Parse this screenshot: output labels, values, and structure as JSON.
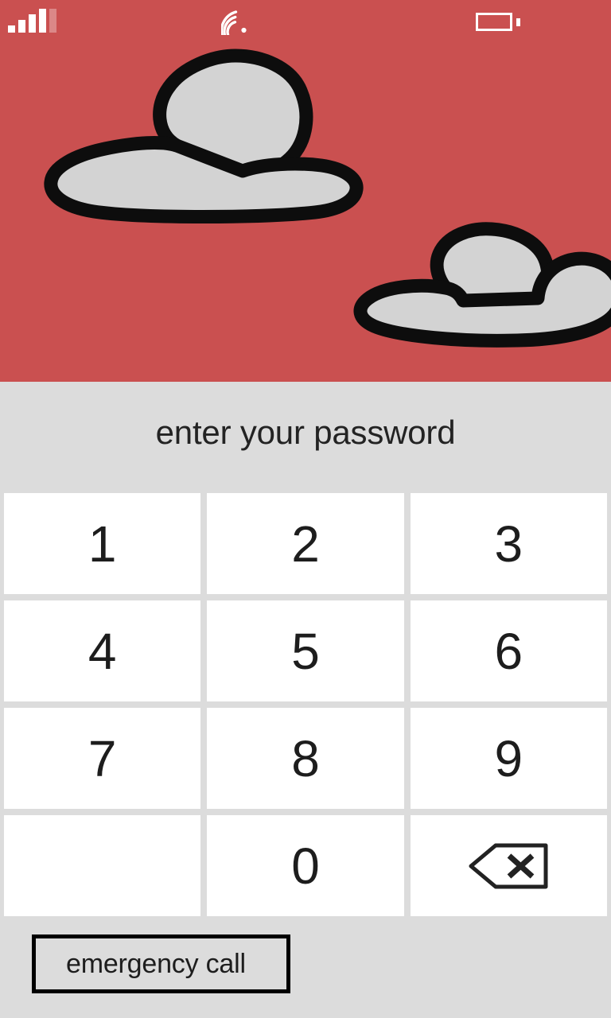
{
  "screen": {
    "name": "lock-screen-password-entry",
    "wallpaper_color": "#CA5050",
    "panel_color": "#DCDCDC",
    "cloud_fill": "#D3D3D3",
    "cloud_stroke": "#0D0D0D"
  },
  "statusbar": {
    "signal_icon": "signal-bars-icon",
    "signal_bars_filled": 4,
    "signal_bars_total": 5,
    "wifi_icon": "wifi-icon",
    "battery_icon": "battery-icon",
    "icon_color": "#FFFFFF"
  },
  "prompt": {
    "text": "enter your password"
  },
  "keypad": {
    "keys": [
      {
        "label": "1",
        "name": "key-1",
        "type": "digit"
      },
      {
        "label": "2",
        "name": "key-2",
        "type": "digit"
      },
      {
        "label": "3",
        "name": "key-3",
        "type": "digit"
      },
      {
        "label": "4",
        "name": "key-4",
        "type": "digit"
      },
      {
        "label": "5",
        "name": "key-5",
        "type": "digit"
      },
      {
        "label": "6",
        "name": "key-6",
        "type": "digit"
      },
      {
        "label": "7",
        "name": "key-7",
        "type": "digit"
      },
      {
        "label": "8",
        "name": "key-8",
        "type": "digit"
      },
      {
        "label": "9",
        "name": "key-9",
        "type": "digit"
      },
      {
        "label": "",
        "name": "key-blank",
        "type": "blank"
      },
      {
        "label": "0",
        "name": "key-0",
        "type": "digit"
      },
      {
        "label": "",
        "name": "key-backspace",
        "type": "backspace",
        "icon": "backspace-icon"
      }
    ],
    "key_background": "#FFFFFF",
    "key_text_color": "#1D1D1D"
  },
  "emergency": {
    "label": "emergency call",
    "border_color": "#000000"
  }
}
